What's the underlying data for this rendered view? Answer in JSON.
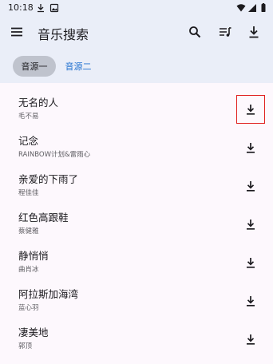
{
  "status_bar": {
    "time": "10:18",
    "left_icons": [
      "download-icon",
      "image-icon"
    ],
    "right_icons": [
      "wifi-icon",
      "signal-icon",
      "battery-icon"
    ]
  },
  "app_bar": {
    "title": "音乐搜索",
    "icons": [
      "menu-icon",
      "search-icon",
      "playlist-icon",
      "download-icon"
    ]
  },
  "sources": {
    "tabs": [
      {
        "label": "音源一",
        "selected": true
      },
      {
        "label": "音源二",
        "selected": false
      }
    ]
  },
  "songs": [
    {
      "title": "无名的人",
      "artist": "毛不易",
      "highlighted": true
    },
    {
      "title": "记念",
      "artist": "RAINBOW计划&雷雨心",
      "highlighted": false
    },
    {
      "title": "亲爱的下雨了",
      "artist": "程佳佳",
      "highlighted": false
    },
    {
      "title": "红色高跟鞋",
      "artist": "蔡健雅",
      "highlighted": false
    },
    {
      "title": "静悄悄",
      "artist": "曲肖冰",
      "highlighted": false
    },
    {
      "title": "阿拉斯加海湾",
      "artist": "蓝心羽",
      "highlighted": false
    },
    {
      "title": "凄美地",
      "artist": "郭顶",
      "highlighted": false
    }
  ],
  "colors": {
    "bar_background": "#eaeef8",
    "list_background": "#fdf8fd",
    "selected_tab": "#bfc3cd",
    "link_blue": "#1f6fcf",
    "highlight_border": "#e02020"
  }
}
